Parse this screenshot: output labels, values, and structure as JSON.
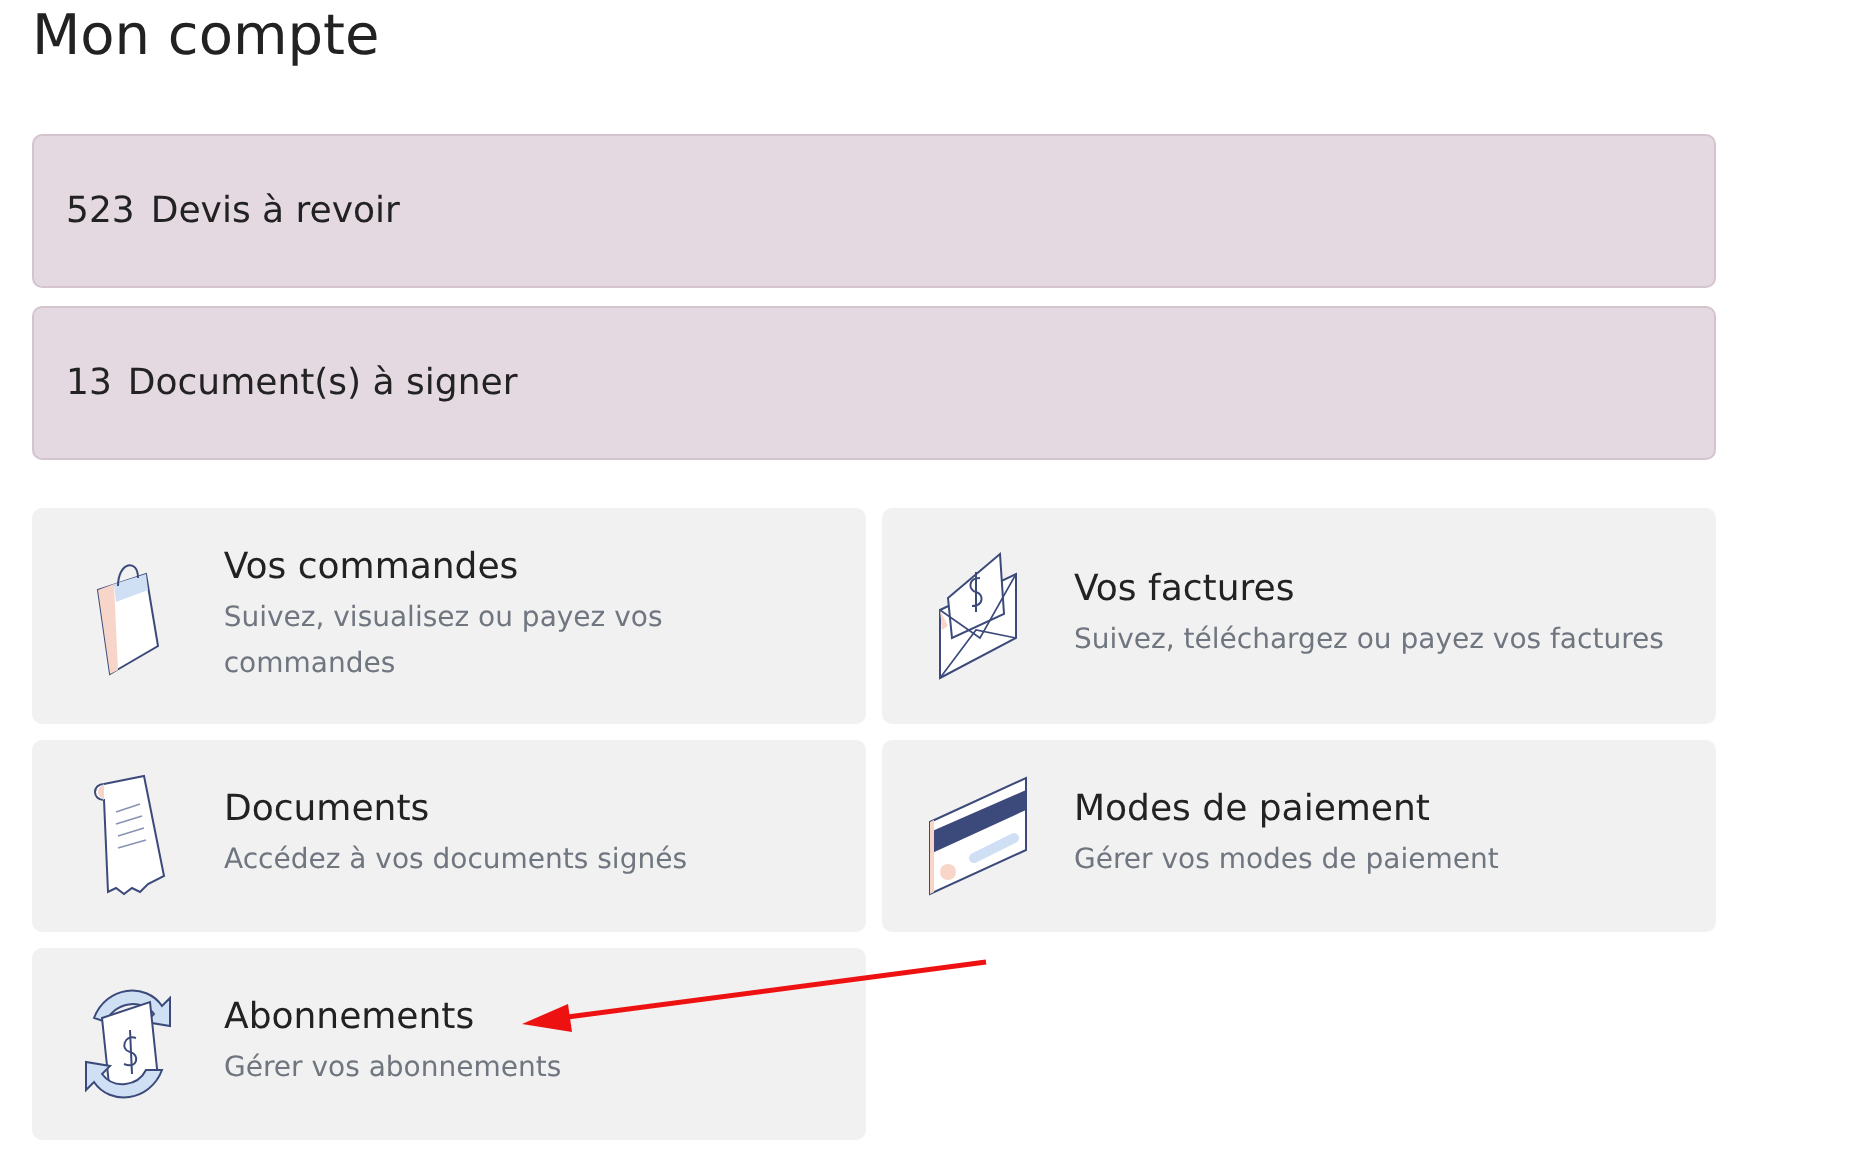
{
  "title": "Mon compte",
  "alerts": [
    {
      "count": "523",
      "label": "Devis à revoir"
    },
    {
      "count": "13",
      "label": "Document(s) à signer"
    }
  ],
  "cards": [
    {
      "kind": "bag",
      "title": "Vos commandes",
      "description": "Suivez, visualisez ou payez vos commandes"
    },
    {
      "kind": "envelope",
      "title": "Vos factures",
      "description": "Suivez, téléchargez ou payez vos factures"
    },
    {
      "kind": "scroll",
      "title": "Documents",
      "description": "Accédez à vos documents signés"
    },
    {
      "kind": "card",
      "title": "Modes de paiement",
      "description": "Gérer vos modes de paiement"
    },
    {
      "kind": "cycle",
      "title": "Abonnements",
      "description": "Gérer vos abonnements"
    }
  ]
}
